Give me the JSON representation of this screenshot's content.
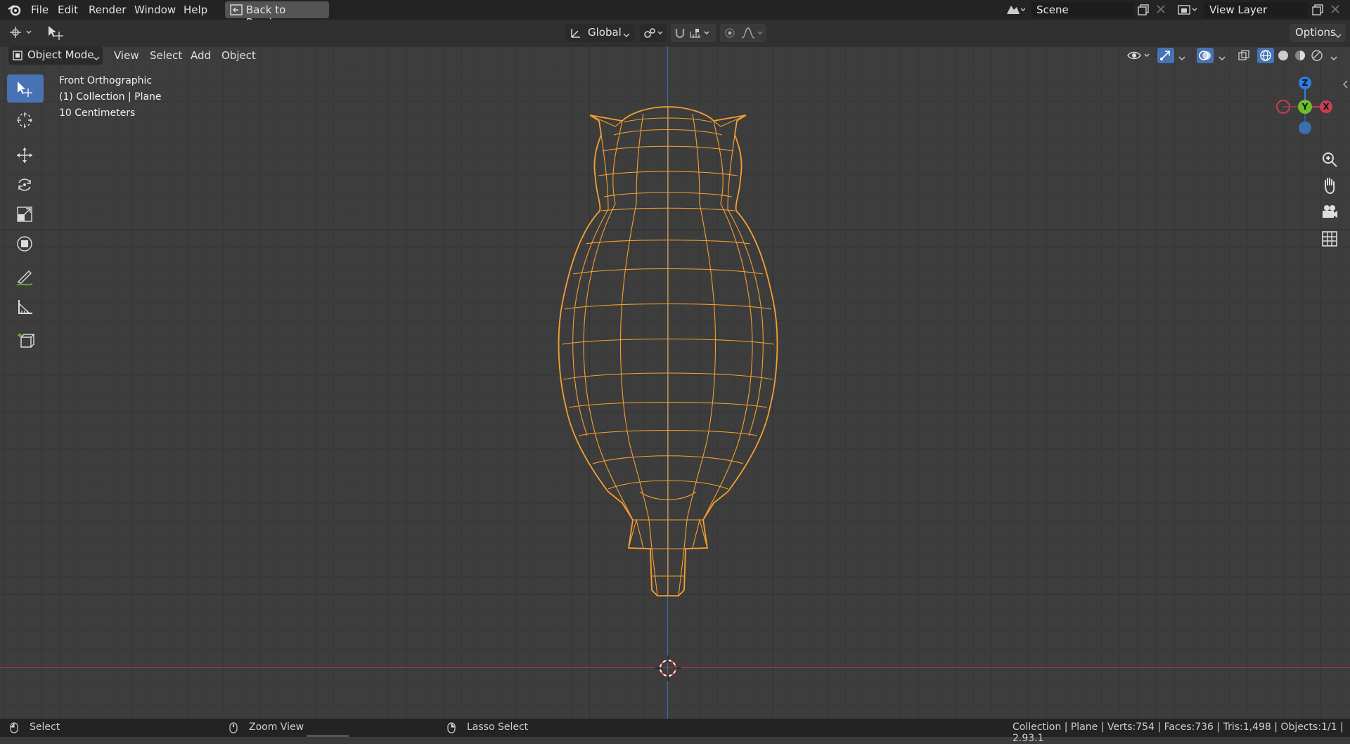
{
  "menu": {
    "file": "File",
    "edit": "Edit",
    "render": "Render",
    "window": "Window",
    "help": "Help",
    "back_to_previous": "Back to Previous"
  },
  "scene": {
    "label": "Scene"
  },
  "view_layer": {
    "label": "View Layer"
  },
  "tool_header": {
    "transform_orientation": "Global",
    "options": "Options"
  },
  "view_header": {
    "mode": "Object Mode",
    "view": "View",
    "select": "Select",
    "add": "Add",
    "object": "Object"
  },
  "viewport": {
    "view_name": "Front Orthographic",
    "collection": "(1) Collection | Plane",
    "scale": "10 Centimeters"
  },
  "gizmo": {
    "z": "Z",
    "y": "Y",
    "x": "X"
  },
  "status": {
    "select": "Select",
    "zoom_view": "Zoom View",
    "lasso_select": "Lasso Select",
    "stats": "Collection | Plane | Verts:754 | Faces:736 | Tris:1,498 | Objects:1/1 | 2.93.1"
  },
  "colors": {
    "accent": "#4772b3",
    "selection": "#f5a030",
    "axis_x": "#c8404f",
    "axis_y": "#6fbf2a",
    "axis_z": "#2f7de1"
  }
}
